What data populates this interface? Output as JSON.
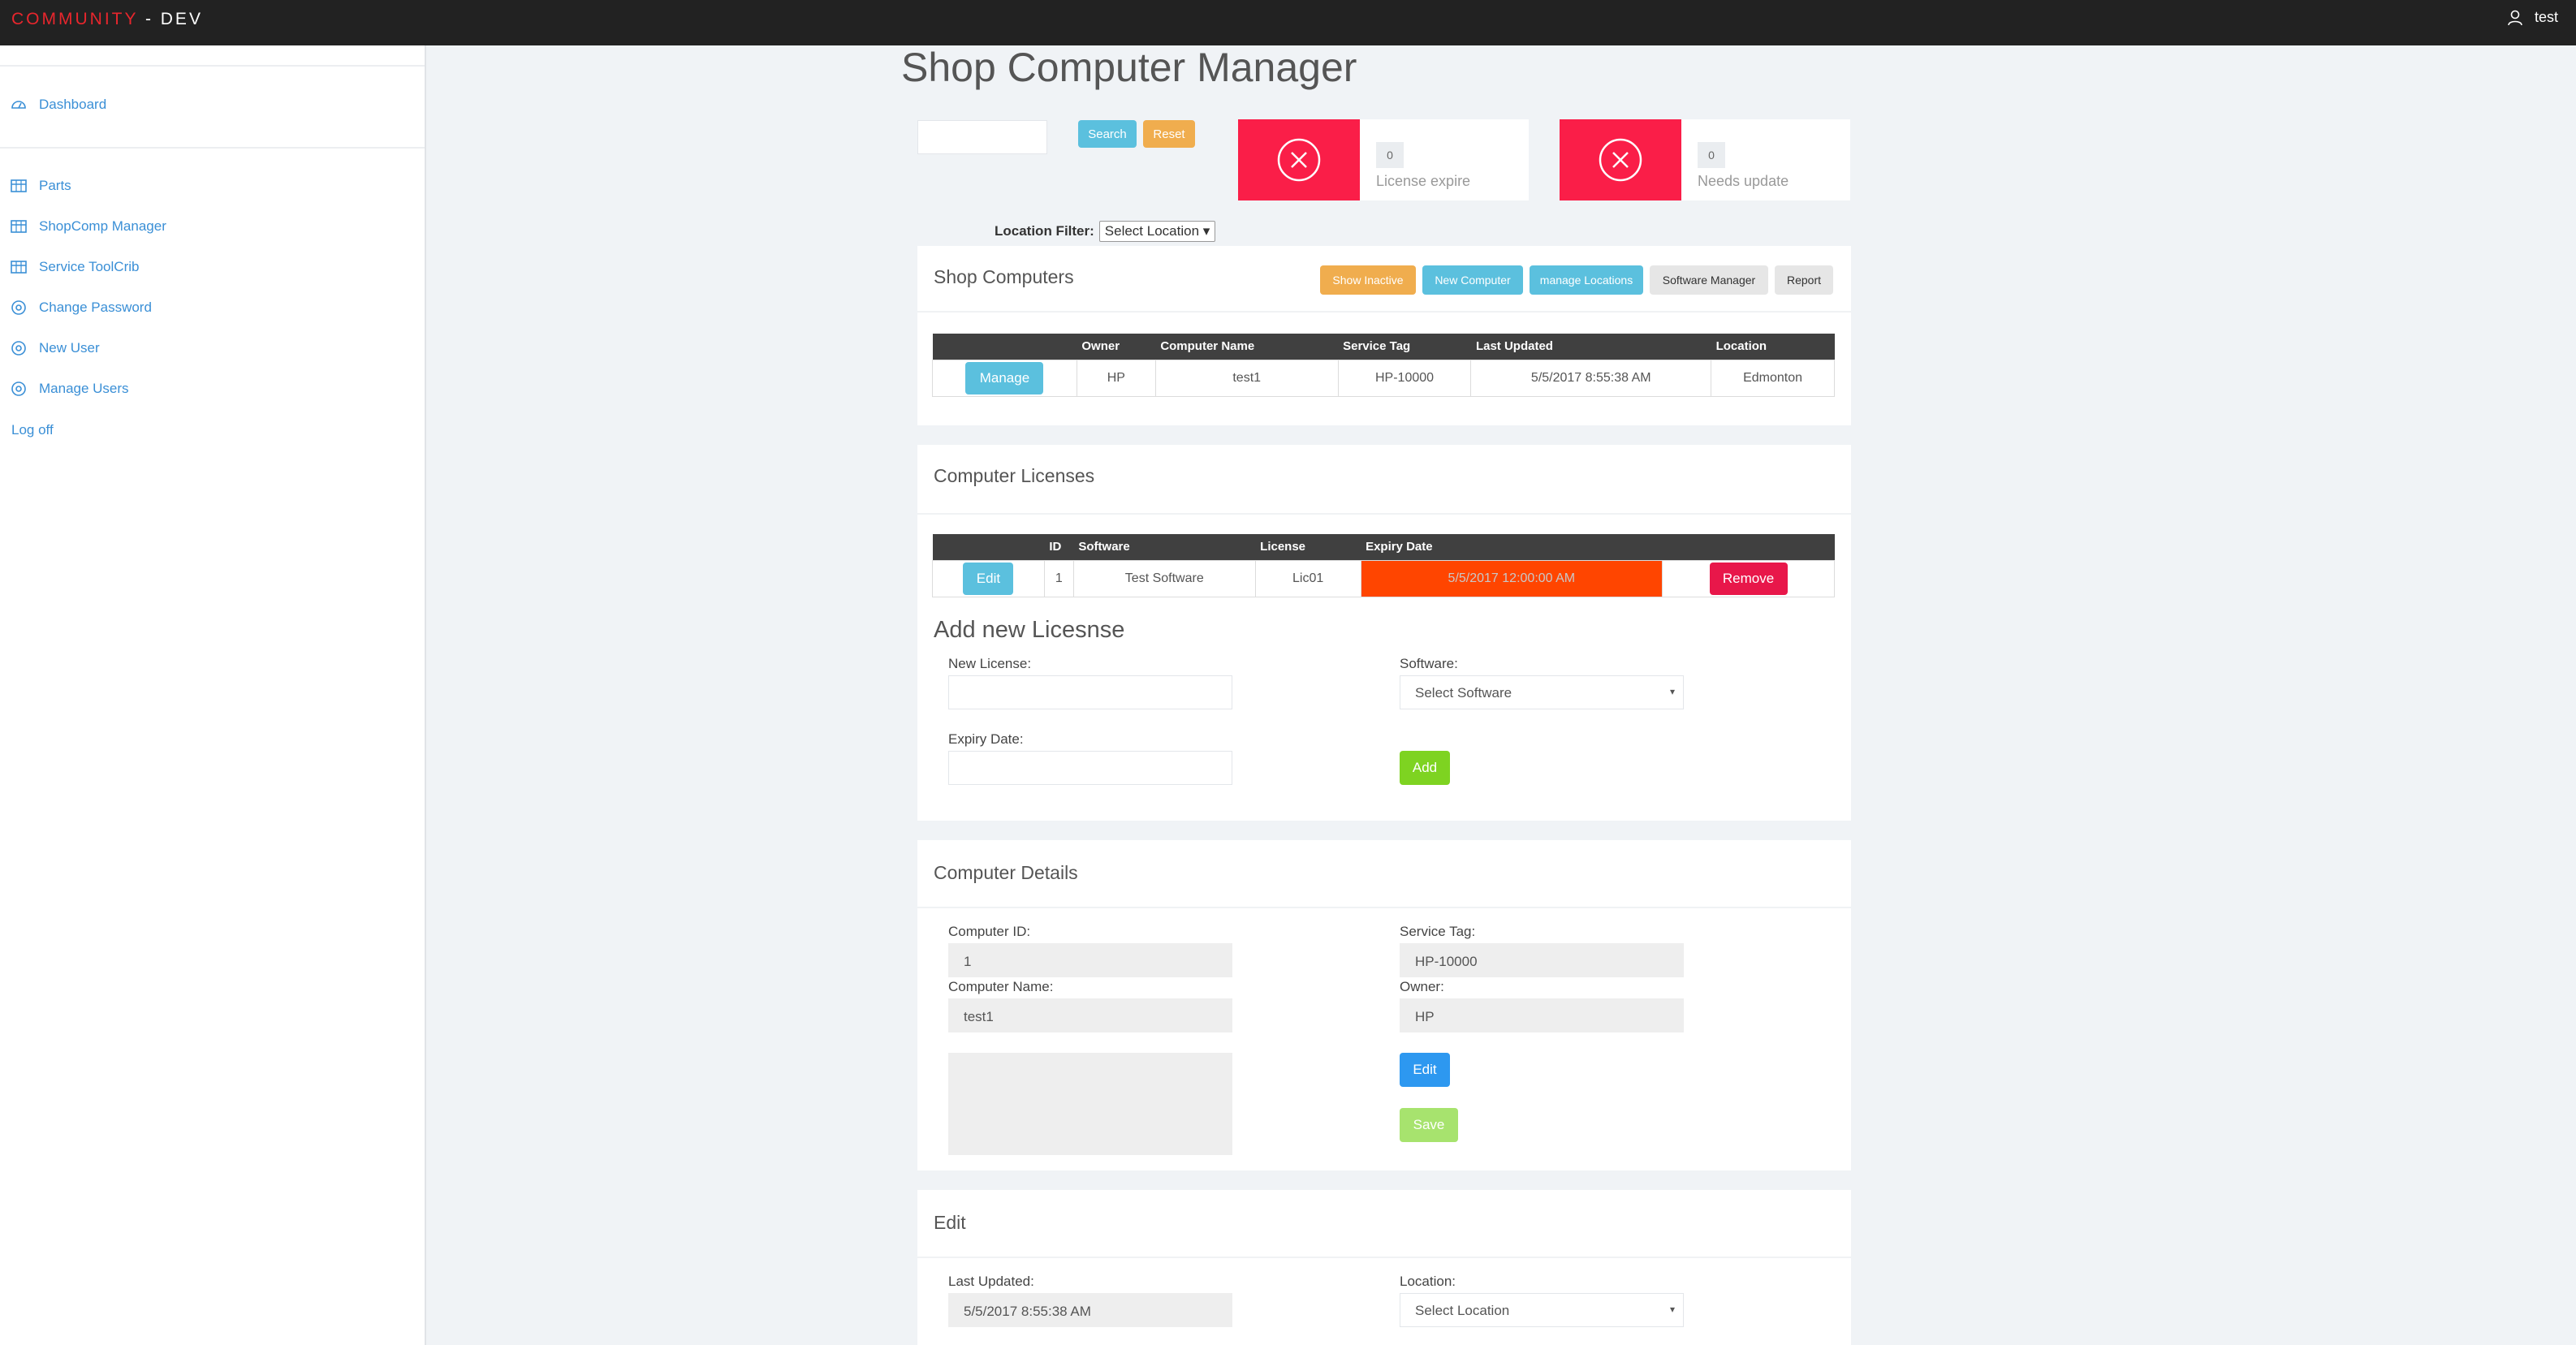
{
  "topbar": {
    "brand_part1": "COMMUNITY",
    "brand_part2": " - DEV",
    "user_name": "test"
  },
  "sidebar": {
    "items": [
      {
        "label": "Dashboard",
        "icon": "dashboard-icon"
      },
      {
        "label": "Parts",
        "icon": "table-icon"
      },
      {
        "label": "ShopComp Manager",
        "icon": "table-icon"
      },
      {
        "label": "Service ToolCrib",
        "icon": "table-icon"
      },
      {
        "label": "Change Password",
        "icon": "settings-icon"
      },
      {
        "label": "New User",
        "icon": "settings-icon"
      },
      {
        "label": "Manage Users",
        "icon": "settings-icon"
      }
    ],
    "logoff": "Log off"
  },
  "page": {
    "title": "Shop Computer Manager"
  },
  "search": {
    "value": "",
    "search_label": "Search",
    "reset_label": "Reset"
  },
  "stats": [
    {
      "count": "0",
      "label": "License expire"
    },
    {
      "count": "0",
      "label": "Needs update"
    }
  ],
  "location_filter": {
    "label": "Location Filter:",
    "selected": "Select Location"
  },
  "shop_computers": {
    "title": "Shop Computers",
    "buttons": {
      "show_inactive": "Show Inactive",
      "new_computer": "New Computer",
      "manage_locations": "manage Locations",
      "software_manager": "Software Manager",
      "report": "Report"
    },
    "columns": [
      "",
      "Owner",
      "Computer Name",
      "Service Tag",
      "Last Updated",
      "Location"
    ],
    "rows": [
      {
        "action": "Manage",
        "owner": "HP",
        "computer_name": "test1",
        "service_tag": "HP-10000",
        "last_updated": "5/5/2017 8:55:38 AM",
        "location": "Edmonton"
      }
    ]
  },
  "licenses": {
    "title": "Computer Licenses",
    "columns": [
      "",
      "ID",
      "Software",
      "License",
      "Expiry Date",
      ""
    ],
    "rows": [
      {
        "action": "Edit",
        "id": "1",
        "software": "Test Software",
        "license": "Lic01",
        "expiry": "5/5/2017 12:00:00 AM",
        "remove": "Remove"
      }
    ],
    "expired_color": "#ff4500"
  },
  "add_license": {
    "title": "Add new Licesnse",
    "new_license_label": "New License:",
    "new_license_value": "",
    "software_label": "Software:",
    "software_selected": "Select Software",
    "expiry_label": "Expiry Date:",
    "expiry_value": "",
    "add_label": "Add"
  },
  "details": {
    "title": "Computer Details",
    "computer_id_label": "Computer ID:",
    "computer_id": "1",
    "service_tag_label": "Service Tag:",
    "service_tag": "HP-10000",
    "computer_name_label": "Computer Name:",
    "computer_name": "test1",
    "owner_label": "Owner:",
    "owner": "HP",
    "notes": "",
    "edit_label": "Edit",
    "save_label": "Save"
  },
  "edit": {
    "title": "Edit",
    "last_updated_label": "Last Updated:",
    "last_updated": "5/5/2017 8:55:38 AM",
    "location_label": "Location:",
    "location_selected": "Select Location"
  }
}
